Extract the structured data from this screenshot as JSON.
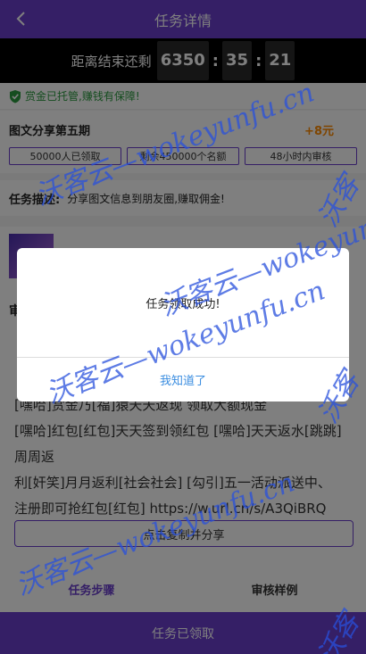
{
  "header": {
    "title": "任务详情"
  },
  "countdown": {
    "label": "距离结束还剩",
    "days": "6350",
    "hours": "35",
    "minutes": "21",
    "separator": ":"
  },
  "guarantee": {
    "text": "赏金已托管,赚钱有保障!"
  },
  "task": {
    "name": "图文分享第五期",
    "reward": "+8元",
    "tags": [
      "50000人已领取",
      "剩余450000个名额",
      "48小时内审核"
    ]
  },
  "description": {
    "label": "任务描述:",
    "text": "分享图文信息到朋友圈,赚取佣金!"
  },
  "content": {
    "heading": "审",
    "share_lines": [
      "[嘿哈]赏金乃[福]猿天天返现 领取大额现金",
      "[嘿哈]红包[红包]天天签到领红包 [嘿哈]天天返水[跳跳]周周返",
      "利[奸笑]月月返利[社会社会] [勾引]五一活动派送中、",
      "注册即可抢红包[红包] https://w.url.cn/s/A3QiBRQ"
    ],
    "copy_button": "点击复制并分享"
  },
  "tabs": [
    {
      "label": "任务步骤"
    },
    {
      "label": "审核样例"
    }
  ],
  "bottom_bar": {
    "label": "任务已领取"
  },
  "modal": {
    "message": "任务领取成功!",
    "confirm": "我知道了"
  },
  "watermarks": [
    "沃客云—wokeyunfu.cn",
    "沃客云—wokeyunfu.cn",
    "沃客云—wokeyunfu.cn",
    "沃客云—wokeyunfu.cn",
    "沃客",
    "沃客",
    "沃客"
  ],
  "colors": {
    "brand": "#6a3fcc",
    "reward": "#ff8a00",
    "guarantee": "#2a9a3e",
    "link": "#3a8de0"
  }
}
